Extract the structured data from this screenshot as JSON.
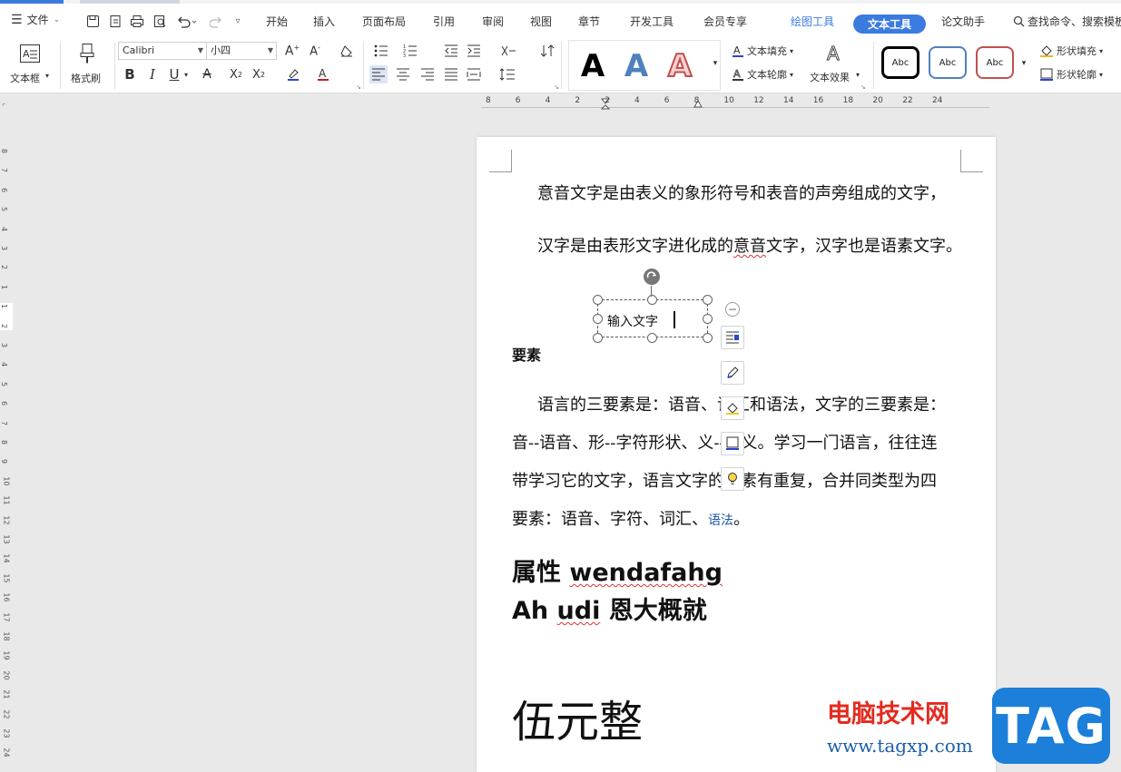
{
  "menubar": {
    "file_label": "文件",
    "tabs": [
      "开始",
      "插入",
      "页面布局",
      "引用",
      "审阅",
      "视图",
      "章节",
      "开发工具",
      "会员专享",
      "绘图工具",
      "文本工具",
      "论文助手"
    ],
    "search_label": "查找命令、搜索模板"
  },
  "ribbon": {
    "textbox_label": "文本框",
    "format_painter_label": "格式刷",
    "font_name": "Calibri",
    "font_size": "小四",
    "bold": "B",
    "italic": "I",
    "underline": "U",
    "style_sample": "A",
    "text_fill_label": "文本填充",
    "text_outline_label": "文本轮廓",
    "text_effect_label": "文本效果",
    "shape_style_sample": "Abc",
    "shape_fill_label": "形状填充",
    "shape_outline_label": "形状轮廓"
  },
  "ruler": {
    "h_ticks": [
      "8",
      "6",
      "4",
      "2",
      "2",
      "4",
      "6",
      "8",
      "10",
      "12",
      "14",
      "16",
      "18",
      "20",
      "22",
      "24"
    ],
    "v_ticks": [
      "8",
      "7",
      "6",
      "5",
      "4",
      "3",
      "2",
      "1",
      "1",
      "2",
      "3",
      "4",
      "5",
      "6",
      "7",
      "8",
      "9",
      "10",
      "11",
      "12",
      "13",
      "14",
      "15",
      "16",
      "17",
      "18",
      "19",
      "20",
      "21",
      "22",
      "23",
      "24"
    ]
  },
  "document": {
    "line1": "意音文字是由表义的象形符号和表音的声旁组成的文字，",
    "line2_a": "汉字是由表形文字进化成的",
    "line2_b": "意音",
    "line2_c": "文字，汉字也是语素文字。",
    "textbox_text": "输入文字",
    "heading": "要素",
    "p1": "语言的三要素是：语音、词汇和语法，文字的三要素是：",
    "p2": "音--语音、形--字符形状、义--意义。学习一门语言，往往连",
    "p3": "带学习它的文字，语言文字的要素有重复，合并同类型为四",
    "p4_a": "要素：语音、字符、词汇、",
    "p4_b": "语法",
    "p4_c": "。",
    "h1_a": "属性 ",
    "h1_b": "wendafahg",
    "h2_a": "Ah ",
    "h2_b": "udi",
    "h2_c": " 恩大概就",
    "big": "伍元整"
  },
  "watermark": {
    "site_name": "电脑技术网",
    "url": "www.tagxp.com",
    "logo": "TAG"
  },
  "colors": {
    "accent": "#3b7be0",
    "spell_underline": "#dd3333",
    "watermark_red": "#e32b20",
    "watermark_blue": "#1b5fa8"
  }
}
